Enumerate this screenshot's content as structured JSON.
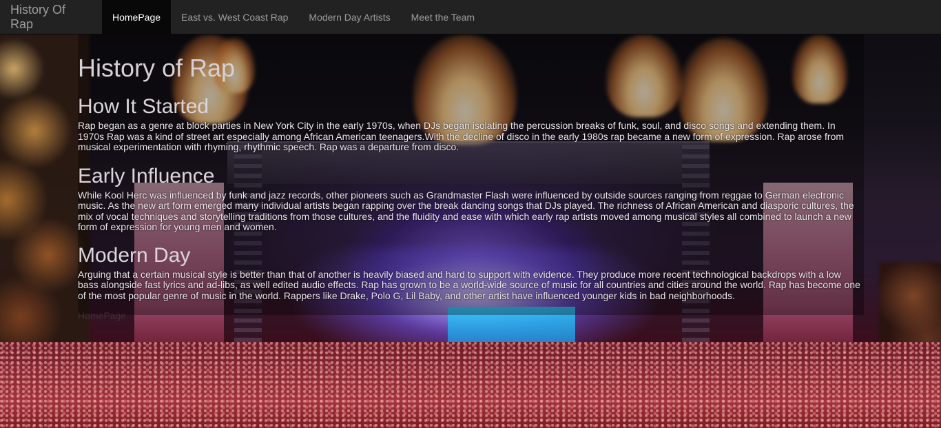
{
  "navbar": {
    "brand": "History Of Rap",
    "links": [
      {
        "label": "HomePage",
        "active": true
      },
      {
        "label": "East vs. West Coast Rap",
        "active": false
      },
      {
        "label": "Modern Day Artists",
        "active": false
      },
      {
        "label": "Meet the Team",
        "active": false
      }
    ]
  },
  "page": {
    "title": "History of Rap",
    "sections": [
      {
        "heading": "How It Started",
        "body": "Rap began as a genre at block parties in New York City in the early 1970s, when DJs began isolating the percussion breaks of funk, soul, and disco songs and extending them. In 1970s Rap was a kind of street art especially among African American teenagers.With the decline of disco in the early 1980s rap became a new form of expression. Rap arose from musical experimentation with rhyming, rhythmic speech. Rap was a departure from disco."
      },
      {
        "heading": "Early Influence",
        "body": "While Kool Herc was influenced by funk and jazz records, other pioneers such as Grandmaster Flash were influenced by outside sources ranging from reggae to German electronic music. As the new art form emerged many individual artists began rapping over the break dancing songs that DJs played. The richness of African American and diasporic cultures, the mix of vocal techniques and storytelling traditions from those cultures, and the fluidity and ease with which early rap artists moved among musical styles all combined to launch a new form of expression for young men and women."
      },
      {
        "heading": "Modern Day",
        "body": "Arguing that a certain musical style is better than that of another is heavily biased and hard to support with evidence. They produce more recent technological backdrops with a low bass alongside fast lyrics and ad-libs, as well edited audio effects. Rap has grown to be a world-wide source of music for all countries and cities around the world. Rap has become one of the most popular genre of music in the world. Rappers like Drake, Polo G, Lil Baby, and other artist have influenced younger kids in bad neighborhoods."
      }
    ],
    "footer_link": "HomePage"
  },
  "background": {
    "image_description_icon": "concert-crowd-stage-image"
  }
}
